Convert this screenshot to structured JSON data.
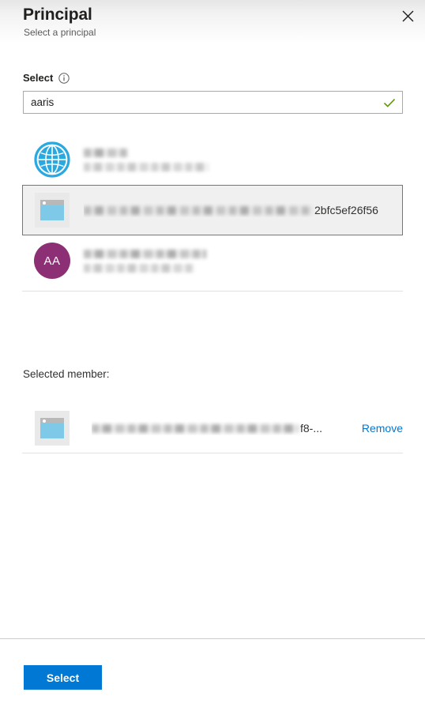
{
  "header": {
    "title": "Principal",
    "subtitle": "Select a principal",
    "close_label": "Close",
    "close_icon": "close-icon"
  },
  "field": {
    "label": "Select",
    "info_icon": "info-icon",
    "value": "aaris",
    "placeholder": "",
    "valid_icon": "checkmark-icon",
    "valid_color": "#5a9e00"
  },
  "results": {
    "items": [
      {
        "icon": "globe-icon",
        "icon_color": "#2aa8e0",
        "primary_redacted": true,
        "primary_width": 55,
        "secondary_redacted": true,
        "secondary_width": 158,
        "visible_tail": "",
        "selected": false
      },
      {
        "icon": "application-icon",
        "icon_color": "#7fc9e8",
        "primary_redacted": true,
        "primary_width": 290,
        "secondary_redacted": false,
        "secondary_width": 0,
        "visible_tail": "2bfc5ef26f56",
        "selected": true
      },
      {
        "icon": "avatar-initials",
        "initials": "AA",
        "icon_color": "#8c2f74",
        "primary_redacted": true,
        "primary_width": 155,
        "secondary_redacted": true,
        "secondary_width": 140,
        "visible_tail": "",
        "selected": false
      }
    ]
  },
  "selected_member": {
    "label": "Selected member:",
    "icon": "application-icon",
    "name_redacted_width": 262,
    "visible_tail": "f8-...",
    "remove_label": "Remove",
    "remove_color": "#0078d4"
  },
  "footer": {
    "submit_label": "Select",
    "submit_color": "#0078d4"
  }
}
